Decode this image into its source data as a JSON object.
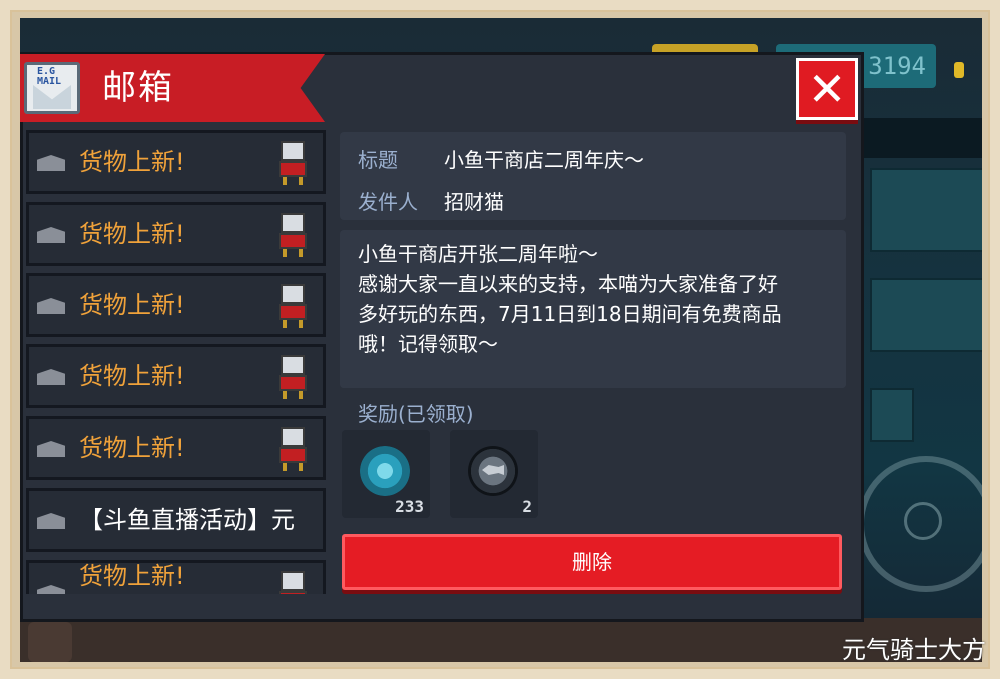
{
  "hud": {
    "counter": "3194"
  },
  "mailbox": {
    "title": "邮箱",
    "icon_text_1": "E.G",
    "icon_text_2": "MAIL"
  },
  "mail_items": [
    {
      "label": "货物上新!",
      "has_cat_icon": true
    },
    {
      "label": "货物上新!",
      "has_cat_icon": true
    },
    {
      "label": "货物上新!",
      "has_cat_icon": true
    },
    {
      "label": "货物上新!",
      "has_cat_icon": true
    },
    {
      "label": "货物上新!",
      "has_cat_icon": true
    },
    {
      "label": "【斗鱼直播活动】元",
      "has_cat_icon": false
    },
    {
      "label": "货物上新!",
      "has_cat_icon": true
    }
  ],
  "detail": {
    "title_key": "标题",
    "title_value": "小鱼干商店二周年庆～",
    "sender_key": "发件人",
    "sender_value": "招财猫",
    "body_lines": [
      "小鱼干商店开张二周年啦～",
      "感谢大家一直以来的支持，本喵为大家准备了好",
      "多好玩的东西，7月11日到18日期间有免费商品",
      "哦！记得领取～"
    ]
  },
  "rewards": {
    "title": "奖励(已领取)",
    "items": [
      {
        "icon": "gem-icon",
        "quantity": "233"
      },
      {
        "icon": "fish-coin-icon",
        "quantity": "2"
      }
    ]
  },
  "actions": {
    "delete_label": "删除",
    "close_symbol": "✕"
  },
  "watermark": "元气骑士大方"
}
